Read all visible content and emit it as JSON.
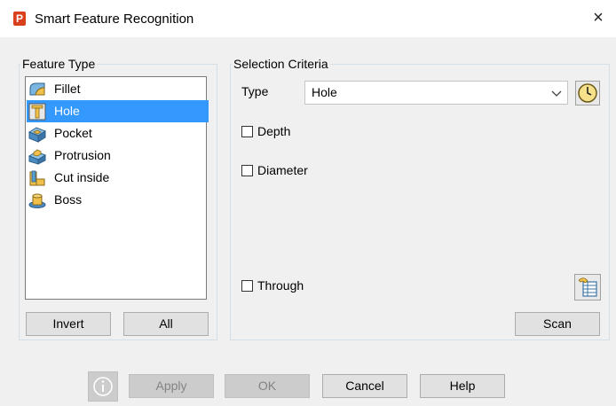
{
  "window": {
    "title": "Smart Feature Recognition",
    "app_icon_letter": "P",
    "close_glyph": "×"
  },
  "feature_type": {
    "legend": "Feature Type",
    "items": [
      {
        "label": "Fillet",
        "icon": "fillet-icon",
        "selected": false
      },
      {
        "label": "Hole",
        "icon": "hole-icon",
        "selected": true
      },
      {
        "label": "Pocket",
        "icon": "pocket-icon",
        "selected": false
      },
      {
        "label": "Protrusion",
        "icon": "protrusion-icon",
        "selected": false
      },
      {
        "label": "Cut inside",
        "icon": "cut-inside-icon",
        "selected": false
      },
      {
        "label": "Boss",
        "icon": "boss-icon",
        "selected": false
      }
    ],
    "invert_label": "Invert",
    "all_label": "All"
  },
  "selection_criteria": {
    "legend": "Selection Criteria",
    "type_label": "Type",
    "type_value": "Hole",
    "depth_label": "Depth",
    "diameter_label": "Diameter",
    "through_label": "Through",
    "scan_label": "Scan"
  },
  "footer": {
    "apply_label": "Apply",
    "ok_label": "OK",
    "cancel_label": "Cancel",
    "help_label": "Help"
  },
  "colors": {
    "selection": "#3399ff",
    "app_icon": "#d9401c"
  }
}
